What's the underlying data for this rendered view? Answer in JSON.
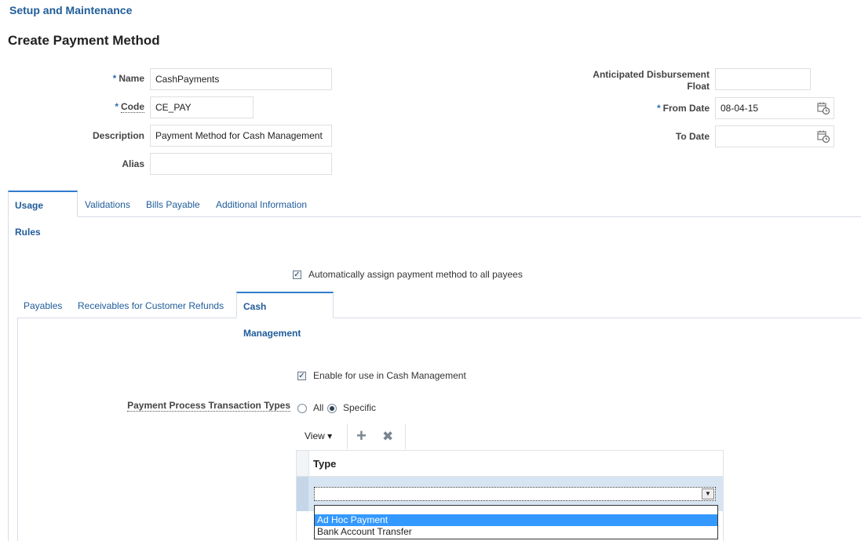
{
  "breadcrumb": "Setup and Maintenance",
  "page_title": "Create Payment Method",
  "form": {
    "name_label": "Name",
    "name_value": "CashPayments",
    "code_label": "Code",
    "code_value": "CE_PAY",
    "description_label": "Description",
    "description_value": "Payment Method for Cash Management",
    "alias_label": "Alias",
    "alias_value": "",
    "float_label_1": "Anticipated Disbursement",
    "float_label_2": "Float",
    "float_value": "",
    "from_date_label": "From Date",
    "from_date_value": "08-04-15",
    "to_date_label": "To Date",
    "to_date_value": "",
    "required_marker": "*"
  },
  "main_tabs": [
    "Usage Rules",
    "Validations",
    "Bills Payable",
    "Additional Information"
  ],
  "auto_assign_label": "Automatically assign payment method to all payees",
  "sub_tabs": [
    "Payables",
    "Receivables for Customer Refunds",
    "Cash Management"
  ],
  "enable_cash_mgmt_label": "Enable for use in Cash Management",
  "ppt_label": "Payment Process Transaction Types",
  "radio_all": "All",
  "radio_specific": "Specific",
  "toolbar": {
    "view_label": "View",
    "view_arrow": "▾",
    "add_icon": "+",
    "delete_icon": "✖"
  },
  "table": {
    "column_header": "Type"
  },
  "dropdown_options": [
    "Ad Hoc Payment",
    "Bank Account Transfer"
  ]
}
